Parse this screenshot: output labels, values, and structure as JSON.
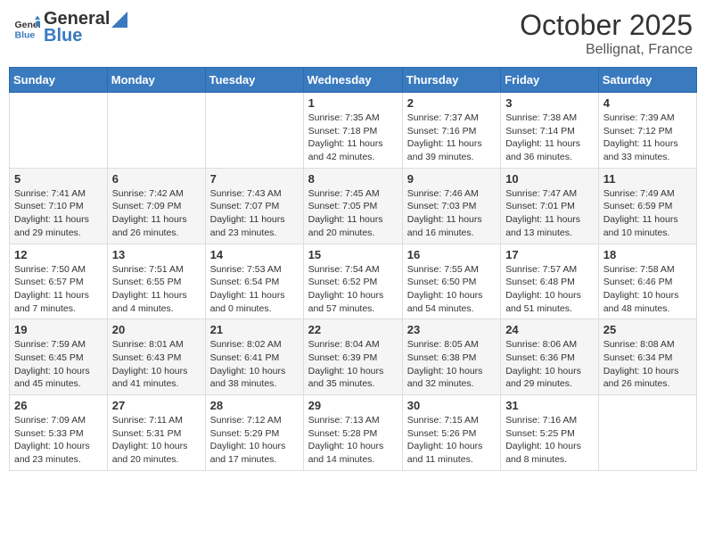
{
  "header": {
    "logo_general": "General",
    "logo_blue": "Blue",
    "month": "October 2025",
    "location": "Bellignat, France"
  },
  "days_of_week": [
    "Sunday",
    "Monday",
    "Tuesday",
    "Wednesday",
    "Thursday",
    "Friday",
    "Saturday"
  ],
  "weeks": [
    [
      {
        "day": "",
        "info": ""
      },
      {
        "day": "",
        "info": ""
      },
      {
        "day": "",
        "info": ""
      },
      {
        "day": "1",
        "info": "Sunrise: 7:35 AM\nSunset: 7:18 PM\nDaylight: 11 hours and 42 minutes."
      },
      {
        "day": "2",
        "info": "Sunrise: 7:37 AM\nSunset: 7:16 PM\nDaylight: 11 hours and 39 minutes."
      },
      {
        "day": "3",
        "info": "Sunrise: 7:38 AM\nSunset: 7:14 PM\nDaylight: 11 hours and 36 minutes."
      },
      {
        "day": "4",
        "info": "Sunrise: 7:39 AM\nSunset: 7:12 PM\nDaylight: 11 hours and 33 minutes."
      }
    ],
    [
      {
        "day": "5",
        "info": "Sunrise: 7:41 AM\nSunset: 7:10 PM\nDaylight: 11 hours and 29 minutes."
      },
      {
        "day": "6",
        "info": "Sunrise: 7:42 AM\nSunset: 7:09 PM\nDaylight: 11 hours and 26 minutes."
      },
      {
        "day": "7",
        "info": "Sunrise: 7:43 AM\nSunset: 7:07 PM\nDaylight: 11 hours and 23 minutes."
      },
      {
        "day": "8",
        "info": "Sunrise: 7:45 AM\nSunset: 7:05 PM\nDaylight: 11 hours and 20 minutes."
      },
      {
        "day": "9",
        "info": "Sunrise: 7:46 AM\nSunset: 7:03 PM\nDaylight: 11 hours and 16 minutes."
      },
      {
        "day": "10",
        "info": "Sunrise: 7:47 AM\nSunset: 7:01 PM\nDaylight: 11 hours and 13 minutes."
      },
      {
        "day": "11",
        "info": "Sunrise: 7:49 AM\nSunset: 6:59 PM\nDaylight: 11 hours and 10 minutes."
      }
    ],
    [
      {
        "day": "12",
        "info": "Sunrise: 7:50 AM\nSunset: 6:57 PM\nDaylight: 11 hours and 7 minutes."
      },
      {
        "day": "13",
        "info": "Sunrise: 7:51 AM\nSunset: 6:55 PM\nDaylight: 11 hours and 4 minutes."
      },
      {
        "day": "14",
        "info": "Sunrise: 7:53 AM\nSunset: 6:54 PM\nDaylight: 11 hours and 0 minutes."
      },
      {
        "day": "15",
        "info": "Sunrise: 7:54 AM\nSunset: 6:52 PM\nDaylight: 10 hours and 57 minutes."
      },
      {
        "day": "16",
        "info": "Sunrise: 7:55 AM\nSunset: 6:50 PM\nDaylight: 10 hours and 54 minutes."
      },
      {
        "day": "17",
        "info": "Sunrise: 7:57 AM\nSunset: 6:48 PM\nDaylight: 10 hours and 51 minutes."
      },
      {
        "day": "18",
        "info": "Sunrise: 7:58 AM\nSunset: 6:46 PM\nDaylight: 10 hours and 48 minutes."
      }
    ],
    [
      {
        "day": "19",
        "info": "Sunrise: 7:59 AM\nSunset: 6:45 PM\nDaylight: 10 hours and 45 minutes."
      },
      {
        "day": "20",
        "info": "Sunrise: 8:01 AM\nSunset: 6:43 PM\nDaylight: 10 hours and 41 minutes."
      },
      {
        "day": "21",
        "info": "Sunrise: 8:02 AM\nSunset: 6:41 PM\nDaylight: 10 hours and 38 minutes."
      },
      {
        "day": "22",
        "info": "Sunrise: 8:04 AM\nSunset: 6:39 PM\nDaylight: 10 hours and 35 minutes."
      },
      {
        "day": "23",
        "info": "Sunrise: 8:05 AM\nSunset: 6:38 PM\nDaylight: 10 hours and 32 minutes."
      },
      {
        "day": "24",
        "info": "Sunrise: 8:06 AM\nSunset: 6:36 PM\nDaylight: 10 hours and 29 minutes."
      },
      {
        "day": "25",
        "info": "Sunrise: 8:08 AM\nSunset: 6:34 PM\nDaylight: 10 hours and 26 minutes."
      }
    ],
    [
      {
        "day": "26",
        "info": "Sunrise: 7:09 AM\nSunset: 5:33 PM\nDaylight: 10 hours and 23 minutes."
      },
      {
        "day": "27",
        "info": "Sunrise: 7:11 AM\nSunset: 5:31 PM\nDaylight: 10 hours and 20 minutes."
      },
      {
        "day": "28",
        "info": "Sunrise: 7:12 AM\nSunset: 5:29 PM\nDaylight: 10 hours and 17 minutes."
      },
      {
        "day": "29",
        "info": "Sunrise: 7:13 AM\nSunset: 5:28 PM\nDaylight: 10 hours and 14 minutes."
      },
      {
        "day": "30",
        "info": "Sunrise: 7:15 AM\nSunset: 5:26 PM\nDaylight: 10 hours and 11 minutes."
      },
      {
        "day": "31",
        "info": "Sunrise: 7:16 AM\nSunset: 5:25 PM\nDaylight: 10 hours and 8 minutes."
      },
      {
        "day": "",
        "info": ""
      }
    ]
  ]
}
